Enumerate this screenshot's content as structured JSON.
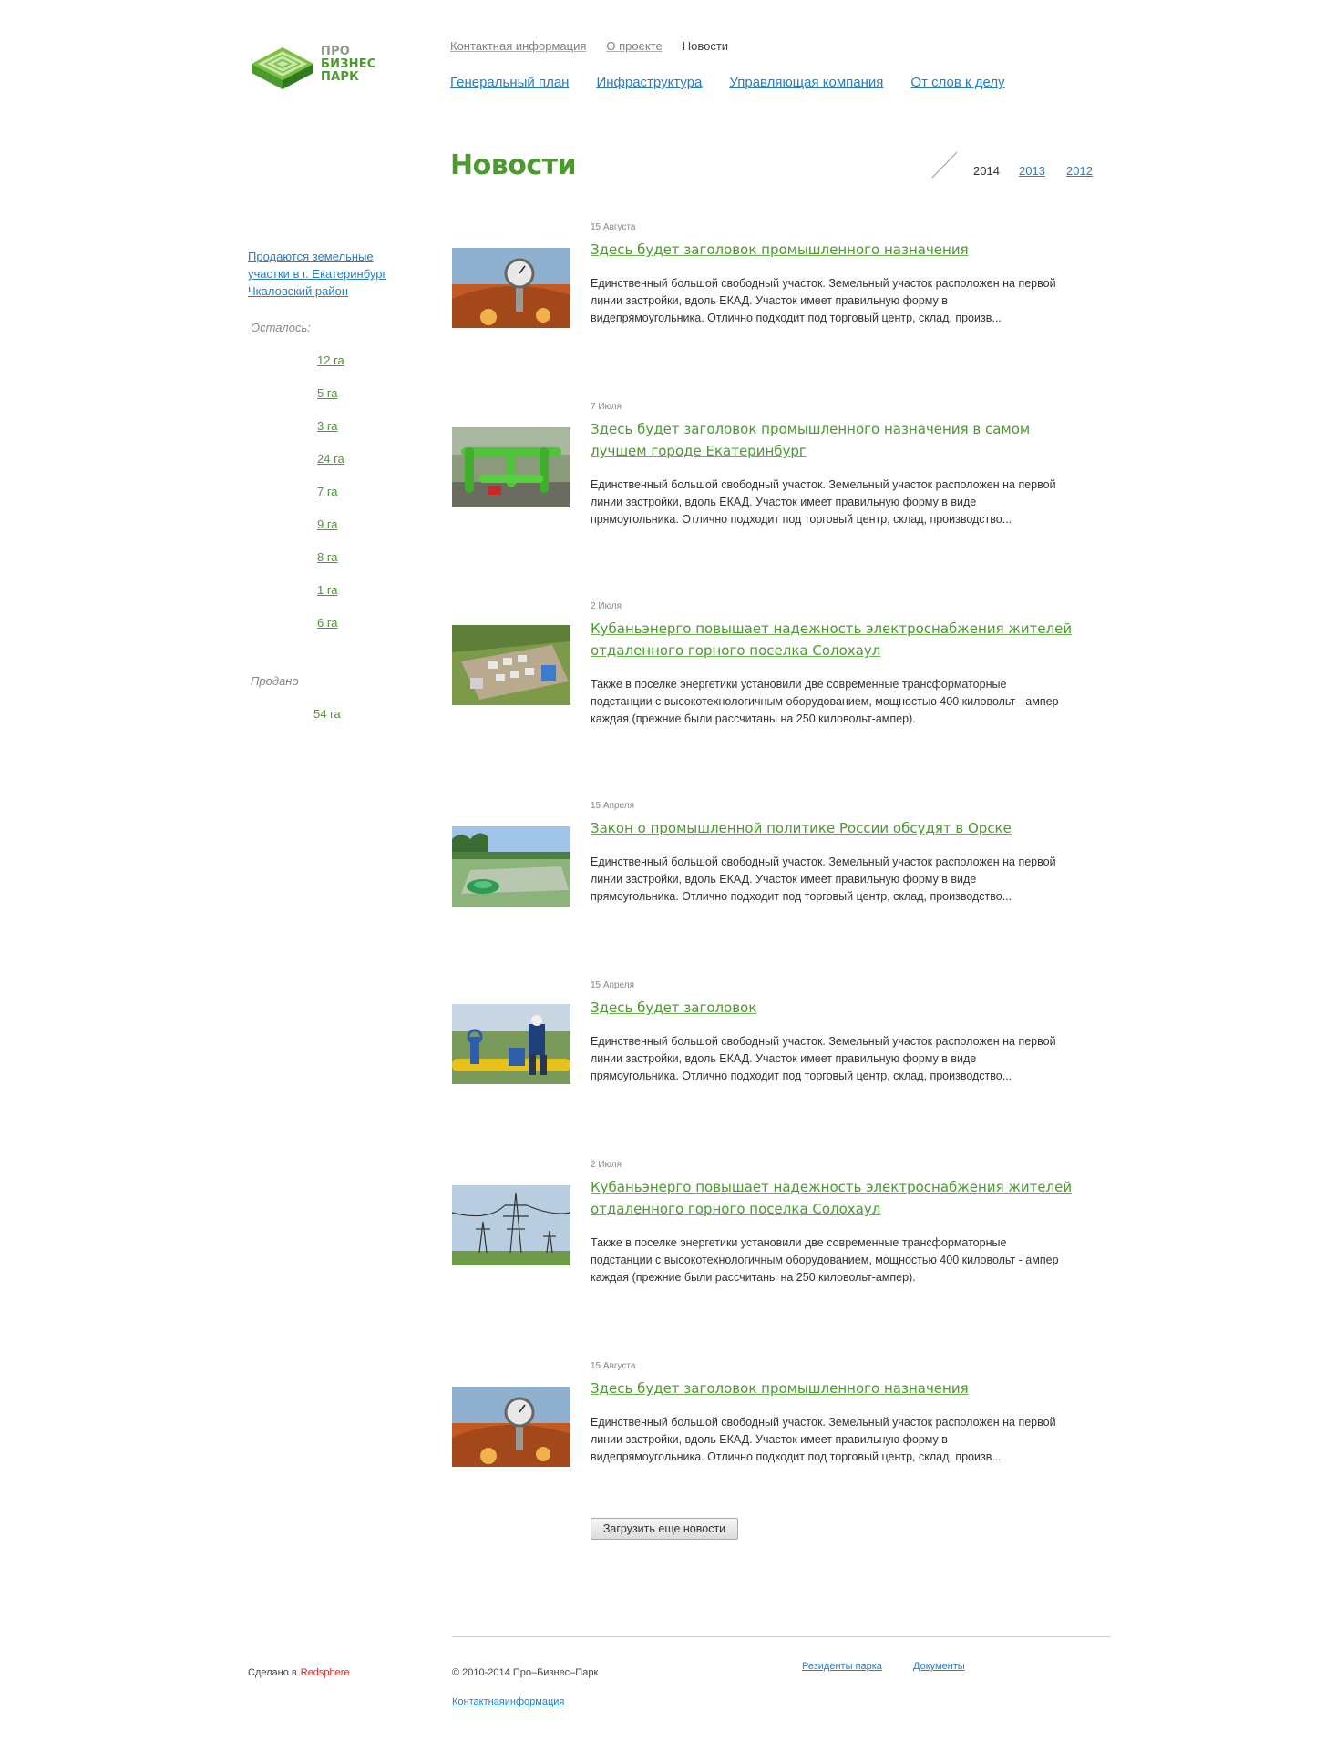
{
  "logo": {
    "line1": "ПРО",
    "line2": "БИЗНЕС",
    "line3": "ПАРК"
  },
  "topnav": {
    "contacts": "Контактная информация",
    "about": "О проекте",
    "news": "Новости"
  },
  "mainnav": {
    "plan": "Генеральный план",
    "infra": "Инфраструктура",
    "company": "Управляющая компания",
    "words": "От слов к делу"
  },
  "page_title": "Новости",
  "years": {
    "current": "2014",
    "y2013": "2013",
    "y2012": "2012"
  },
  "sidebar": {
    "promo": "Продаются земельные участки в г. Екатеринбург Чкаловский район",
    "remaining_label": "Осталось:",
    "plots": [
      "12 га",
      "5 га",
      "3 га",
      "24 га",
      "7 га",
      "9 га",
      "8 га",
      "1 га",
      "6 га"
    ],
    "sold_label": "Продано",
    "sold_value": "54 га"
  },
  "news": [
    {
      "date": "15 Августа",
      "title": "Здесь будет заголовок промышленного назначения",
      "text": "Единственный большой свободный участок. Земельный участок расположен на первой линии застройки, вдоль ЕКАД. Участок имеет правильную форму в видепрямоугольника. Отлично подходит под торговый центр, склад, произв...",
      "image": "gauge"
    },
    {
      "date": "7 Июля",
      "title": "Здесь будет заголовок промышленного назначения в самом лучшем городе Екатеринбург",
      "text": "Единственный большой свободный участок. Земельный участок расположен на первой линии застройки, вдоль ЕКАД. Участок имеет правильную форму в виде прямоугольника. Отлично подходит под торговый центр, склад, производство...",
      "image": "pipes"
    },
    {
      "date": "2 Июля",
      "title": "Кубаньэнерго повышает надежность электроснабжения жителей отдаленного горного поселка Солохаул",
      "text": "Также в поселке энергетики установили две современные трансформаторные подстанции с высокотехнологичным оборудованием, мощностью 400 киловольт - ампер каждая (прежние были рассчитаны на 250 киловольт-ампер).",
      "image": "substation"
    },
    {
      "date": "15 Апреля",
      "title": "Закон о промышленной политике России обсудят в Орске",
      "text": "Единственный большой свободный участок. Земельный участок расположен на первой линии застройки, вдоль ЕКАД. Участок имеет правильную форму в виде прямоугольника. Отлично подходит под торговый центр, склад, производство...",
      "image": "reservoir"
    },
    {
      "date": "15 Апреля",
      "title": "Здесь будет заголовок",
      "text": "Единственный большой свободный участок. Земельный участок расположен на первой линии застройки, вдоль ЕКАД. Участок имеет правильную форму в виде прямоугольника. Отлично подходит под торговый центр, склад, производство...",
      "image": "worker"
    },
    {
      "date": "2 Июля",
      "title": "Кубаньэнерго повышает надежность электроснабжения жителей отдаленного горного поселка Солохаул",
      "text": "Также в поселке энергетики установили две современные трансформаторные подстанции с высокотехнологичным оборудованием, мощностью 400 киловольт - ампер каждая (прежние были рассчитаны на 250 киловольт-ампер).",
      "image": "pylons"
    },
    {
      "date": "15 Августа",
      "title": "Здесь будет заголовок промышленного назначения",
      "text": "Единственный большой свободный участок. Земельный участок расположен на первой линии застройки, вдоль ЕКАД. Участок имеет правильную форму в видепрямоугольника. Отлично подходит под торговый центр, склад, произв...",
      "image": "gauge"
    }
  ],
  "load_more": "Загрузить еще новости",
  "footer": {
    "made_by": "Сделано в",
    "made_brand": "Redsphere",
    "copyright": "© 2010-2014 Про–Бизнес–Парк",
    "residents": "Резиденты парка",
    "documents": "Документы",
    "contact": "Контактнаяинформация"
  },
  "colors": {
    "green": "#4a9a2e",
    "link_blue": "#2a7dc3",
    "brand_red": "#e0221f"
  }
}
